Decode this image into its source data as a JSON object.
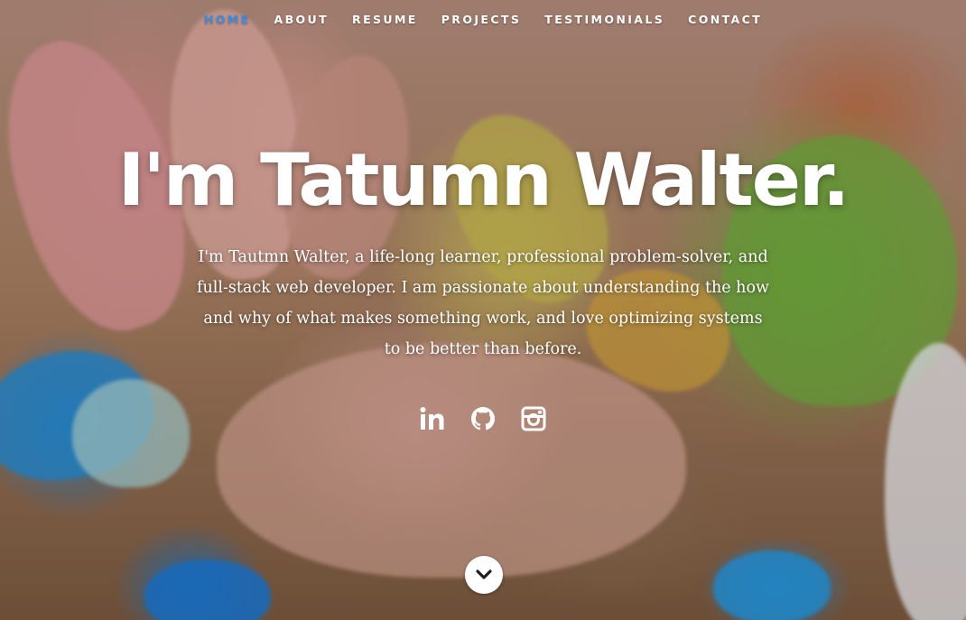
{
  "nav": {
    "items": [
      {
        "label": "HOME",
        "active": true
      },
      {
        "label": "ABOUT",
        "active": false
      },
      {
        "label": "RESUME",
        "active": false
      },
      {
        "label": "PROJECTS",
        "active": false
      },
      {
        "label": "TESTIMONIALS",
        "active": false
      },
      {
        "label": "CONTACT",
        "active": false
      }
    ],
    "active_color": "#3c8ce0"
  },
  "hero": {
    "title": "I'm Tatumn Walter.",
    "bio": "I'm Tautmn Walter, a life-long learner, professional problem-solver, and full-stack web developer. I am passionate about understanding the how and why of what makes something work, and love optimizing systems to be better than before."
  },
  "social": [
    {
      "icon": "linkedin-icon"
    },
    {
      "icon": "github-icon"
    },
    {
      "icon": "instagram-icon"
    }
  ],
  "scroll_button": {
    "icon": "chevron-down-icon"
  }
}
